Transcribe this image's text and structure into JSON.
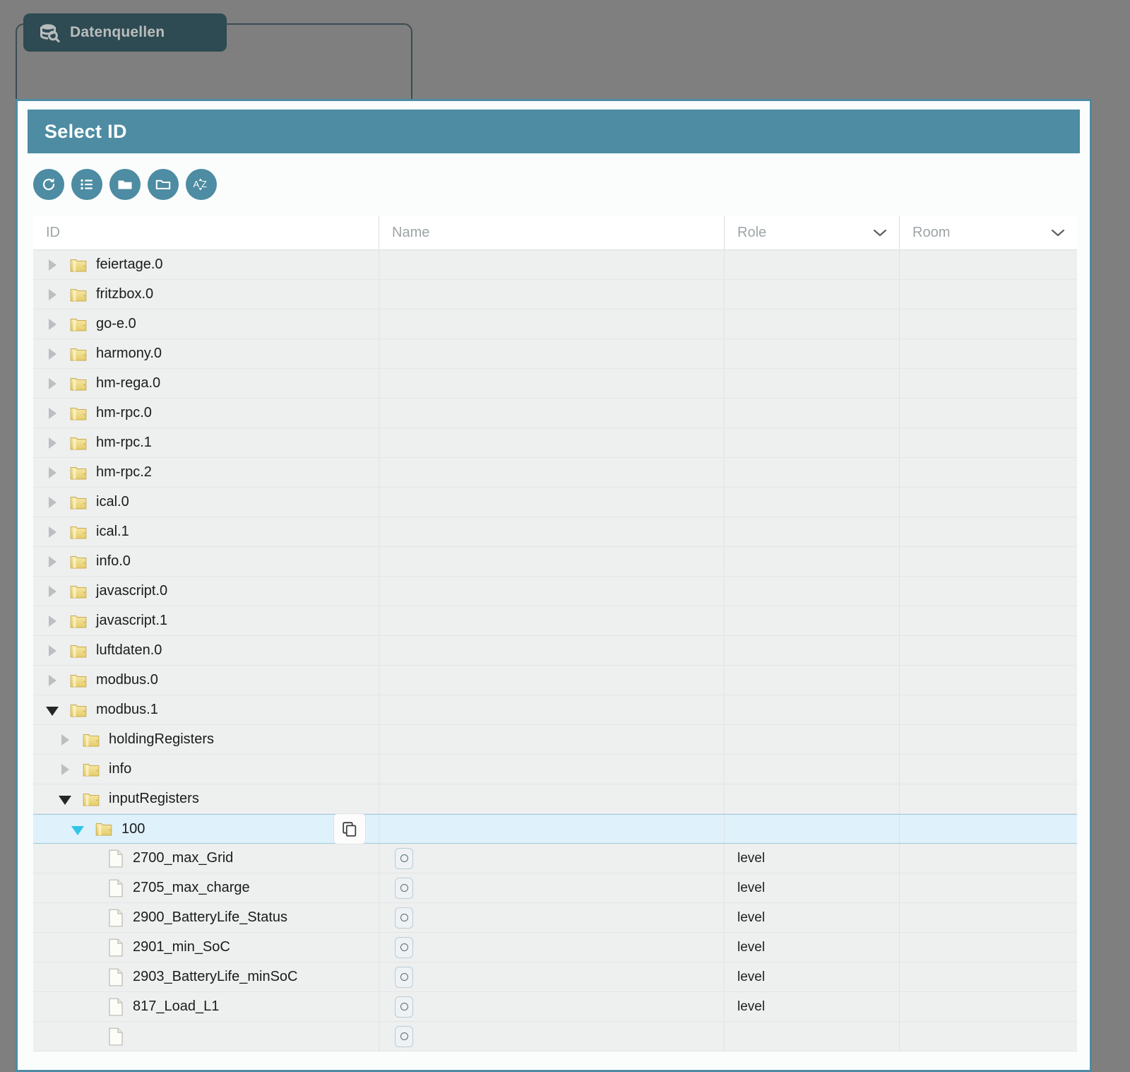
{
  "background": {
    "tab_label": "Datenquellen",
    "tab_icon": "database-search-icon"
  },
  "dialog": {
    "title": "Select ID",
    "accent_color": "#4d8ca2",
    "selected_row_color": "#dff1fa"
  },
  "toolbar": {
    "buttons": [
      {
        "name": "refresh-button",
        "icon": "refresh-icon"
      },
      {
        "name": "list-view-button",
        "icon": "list-icon"
      },
      {
        "name": "expand-all-button",
        "icon": "folder-filled-icon"
      },
      {
        "name": "collapse-all-button",
        "icon": "folder-outline-icon"
      },
      {
        "name": "sort-az-button",
        "icon": "sort-alpha-icon",
        "label": "AZ"
      }
    ]
  },
  "columns": [
    {
      "key": "id",
      "label": "ID",
      "filter": true
    },
    {
      "key": "name",
      "label": "Name",
      "filter": true
    },
    {
      "key": "role",
      "label": "Role",
      "dropdown": true
    },
    {
      "key": "room",
      "label": "Room",
      "dropdown": true
    }
  ],
  "rows": [
    {
      "id": "feiertage.0",
      "indent": 0,
      "type": "folder",
      "state": "collapsed",
      "name": "",
      "role": "",
      "room": ""
    },
    {
      "id": "fritzbox.0",
      "indent": 0,
      "type": "folder",
      "state": "collapsed",
      "name": "",
      "role": "",
      "room": ""
    },
    {
      "id": "go-e.0",
      "indent": 0,
      "type": "folder",
      "state": "collapsed",
      "name": "",
      "role": "",
      "room": ""
    },
    {
      "id": "harmony.0",
      "indent": 0,
      "type": "folder",
      "state": "collapsed",
      "name": "",
      "role": "",
      "room": ""
    },
    {
      "id": "hm-rega.0",
      "indent": 0,
      "type": "folder",
      "state": "collapsed",
      "name": "",
      "role": "",
      "room": ""
    },
    {
      "id": "hm-rpc.0",
      "indent": 0,
      "type": "folder",
      "state": "collapsed",
      "name": "",
      "role": "",
      "room": ""
    },
    {
      "id": "hm-rpc.1",
      "indent": 0,
      "type": "folder",
      "state": "collapsed",
      "name": "",
      "role": "",
      "room": ""
    },
    {
      "id": "hm-rpc.2",
      "indent": 0,
      "type": "folder",
      "state": "collapsed",
      "name": "",
      "role": "",
      "room": ""
    },
    {
      "id": "ical.0",
      "indent": 0,
      "type": "folder",
      "state": "collapsed",
      "name": "",
      "role": "",
      "room": ""
    },
    {
      "id": "ical.1",
      "indent": 0,
      "type": "folder",
      "state": "collapsed",
      "name": "",
      "role": "",
      "room": ""
    },
    {
      "id": "info.0",
      "indent": 0,
      "type": "folder",
      "state": "collapsed",
      "name": "",
      "role": "",
      "room": ""
    },
    {
      "id": "javascript.0",
      "indent": 0,
      "type": "folder",
      "state": "collapsed",
      "name": "",
      "role": "",
      "room": ""
    },
    {
      "id": "javascript.1",
      "indent": 0,
      "type": "folder",
      "state": "collapsed",
      "name": "",
      "role": "",
      "room": ""
    },
    {
      "id": "luftdaten.0",
      "indent": 0,
      "type": "folder",
      "state": "collapsed",
      "name": "",
      "role": "",
      "room": ""
    },
    {
      "id": "modbus.0",
      "indent": 0,
      "type": "folder",
      "state": "collapsed",
      "name": "",
      "role": "",
      "room": ""
    },
    {
      "id": "modbus.1",
      "indent": 0,
      "type": "folder",
      "state": "expanded",
      "name": "",
      "role": "",
      "room": ""
    },
    {
      "id": "holdingRegisters",
      "indent": 1,
      "type": "folder",
      "state": "collapsed",
      "name": "",
      "role": "",
      "room": ""
    },
    {
      "id": "info",
      "indent": 1,
      "type": "folder",
      "state": "collapsed",
      "name": "",
      "role": "",
      "room": ""
    },
    {
      "id": "inputRegisters",
      "indent": 1,
      "type": "folder",
      "state": "expanded",
      "name": "",
      "role": "",
      "room": ""
    },
    {
      "id": "100",
      "indent": 2,
      "type": "folder",
      "state": "expanded",
      "name": "",
      "role": "",
      "room": "",
      "selected": true,
      "copy_button": true
    },
    {
      "id": "2700_max_Grid",
      "indent": 3,
      "type": "file",
      "state": "leaf",
      "name": "state-dot",
      "role": "level",
      "room": ""
    },
    {
      "id": "2705_max_charge",
      "indent": 3,
      "type": "file",
      "state": "leaf",
      "name": "state-dot",
      "role": "level",
      "room": ""
    },
    {
      "id": "2900_BatteryLife_Status",
      "indent": 3,
      "type": "file",
      "state": "leaf",
      "name": "state-dot",
      "role": "level",
      "room": ""
    },
    {
      "id": "2901_min_SoC",
      "indent": 3,
      "type": "file",
      "state": "leaf",
      "name": "state-dot",
      "role": "level",
      "room": ""
    },
    {
      "id": "2903_BatteryLife_minSoC",
      "indent": 3,
      "type": "file",
      "state": "leaf",
      "name": "state-dot",
      "role": "level",
      "room": ""
    },
    {
      "id": "817_Load_L1",
      "indent": 3,
      "type": "file",
      "state": "leaf",
      "name": "state-dot",
      "role": "level",
      "room": ""
    },
    {
      "id": "",
      "indent": 3,
      "type": "file",
      "state": "leaf",
      "name": "state-dot",
      "role": "",
      "room": "",
      "partial": true
    }
  ]
}
